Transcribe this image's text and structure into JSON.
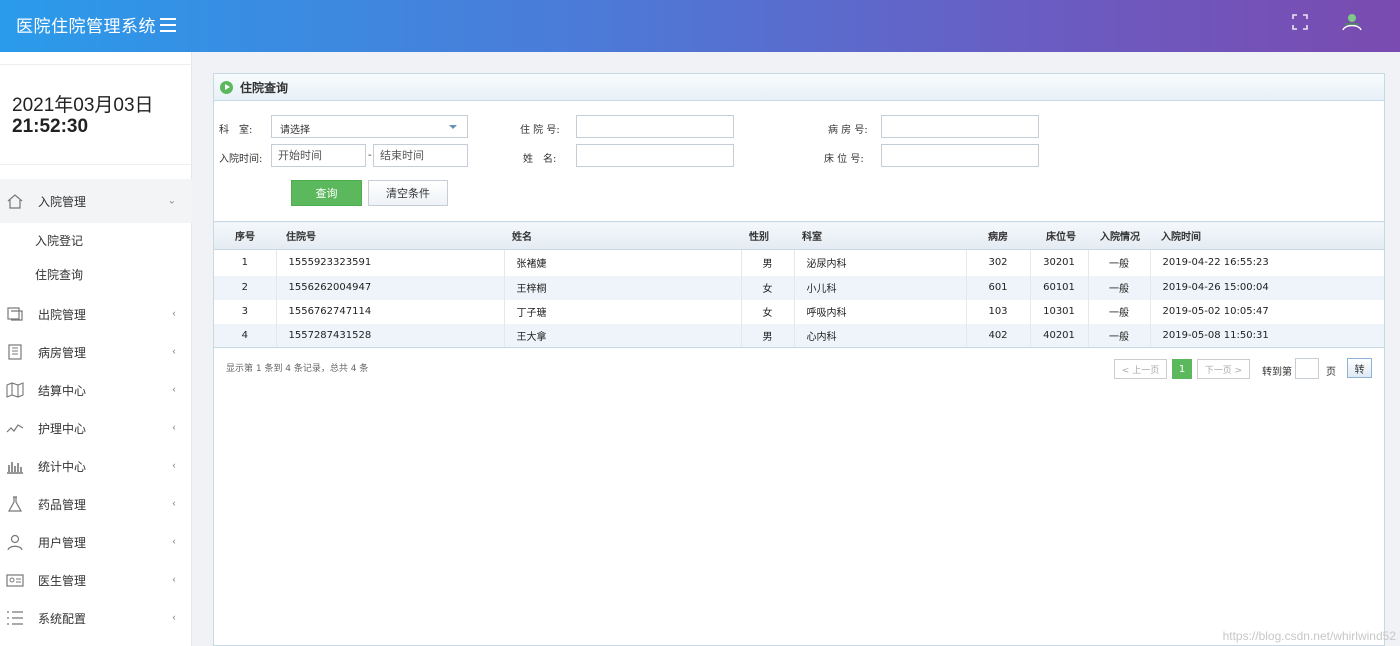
{
  "header": {
    "title": "医院住院管理系统"
  },
  "clock": {
    "date": "2021年03月03日",
    "time": "21:52:30"
  },
  "sidebar": {
    "groups": [
      {
        "label": "入院管理",
        "icon": "home-icon",
        "expanded": true,
        "children": [
          "入院登记",
          "住院查询"
        ]
      },
      {
        "label": "出院管理",
        "icon": "exit-icon"
      },
      {
        "label": "病房管理",
        "icon": "building-icon"
      },
      {
        "label": "结算中心",
        "icon": "map-icon"
      },
      {
        "label": "护理中心",
        "icon": "trend-icon"
      },
      {
        "label": "统计中心",
        "icon": "bar-chart-icon"
      },
      {
        "label": "药品管理",
        "icon": "flask-icon"
      },
      {
        "label": "用户管理",
        "icon": "user-icon"
      },
      {
        "label": "医生管理",
        "icon": "id-card-icon"
      },
      {
        "label": "系统配置",
        "icon": "list-icon"
      }
    ]
  },
  "panel": {
    "title": "住院查询"
  },
  "form": {
    "dept_label": "科　室:",
    "dept_value": "请选择",
    "admit_time_label": "入院时间:",
    "start_placeholder": "开始时间",
    "dash": "-",
    "end_placeholder": "结束时间",
    "inpatient_no_label": "住 院 号:",
    "name_label": "姓　名:",
    "ward_no_label": "病 房 号:",
    "bed_no_label": "床 位 号:",
    "query_button": "查询",
    "clear_button": "清空条件"
  },
  "table": {
    "headers": [
      "序号",
      "住院号",
      "姓名",
      "性别",
      "科室",
      "病房",
      "床位号",
      "入院情况",
      "入院时间"
    ],
    "rows": [
      [
        "1",
        "1555923323591",
        "张褚婕",
        "男",
        "泌尿内科",
        "302",
        "30201",
        "一般",
        "2019-04-22 16:55:23"
      ],
      [
        "2",
        "1556262004947",
        "王梓桐",
        "女",
        "小儿科",
        "601",
        "60101",
        "一般",
        "2019-04-26 15:00:04"
      ],
      [
        "3",
        "1556762747114",
        "丁子瑭",
        "女",
        "呼吸内科",
        "103",
        "10301",
        "一般",
        "2019-05-02 10:05:47"
      ],
      [
        "4",
        "1557287431528",
        "王大拿",
        "男",
        "心内科",
        "402",
        "40201",
        "一般",
        "2019-05-08 11:50:31"
      ]
    ]
  },
  "pager": {
    "info": "显示第 1 条到 4 条记录，总共 4 条",
    "prev": "< 上一页",
    "current": "1",
    "next": "下一页 >",
    "goto_label": "转到第",
    "page_unit": "页",
    "goto_button": "转"
  },
  "watermark": "https://blog.csdn.net/whirlwind52"
}
